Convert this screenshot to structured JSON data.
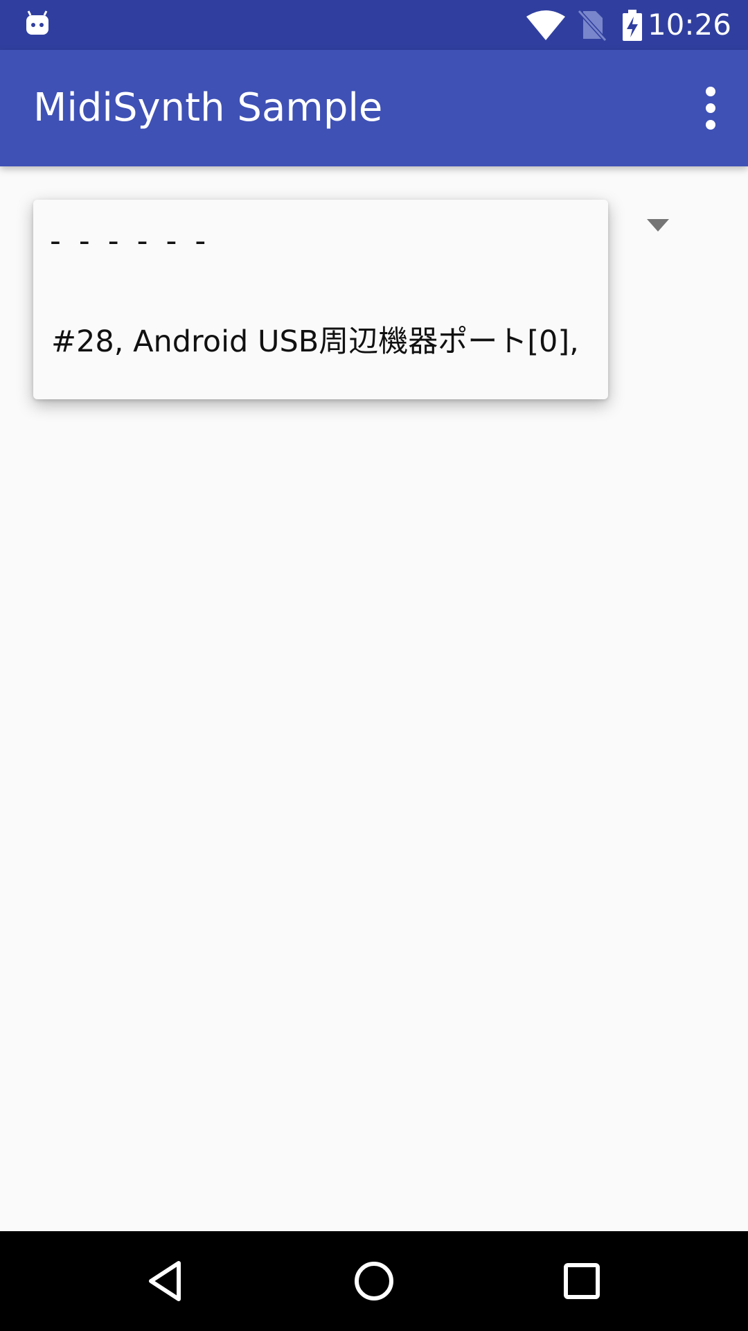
{
  "status_bar": {
    "time": "10:26",
    "icons": [
      "android-robot-icon",
      "wifi-icon",
      "no-sim-icon",
      "battery-charging-icon"
    ]
  },
  "app_bar": {
    "title": "MidiSynth Sample",
    "overflow_icon": "more-vert-icon"
  },
  "spinner": {
    "arrow_icon": "dropdown-arrow-icon",
    "options": [
      "- - - - - -",
      "#28, Android USB周辺機器ポート[0],"
    ]
  },
  "nav_bar": {
    "icons": [
      "back-icon",
      "home-icon",
      "recents-icon"
    ]
  },
  "colors": {
    "status_bar": "#303f9f",
    "app_bar": "#3f51b5",
    "background": "#fafafa",
    "nav_bar": "#000000"
  }
}
